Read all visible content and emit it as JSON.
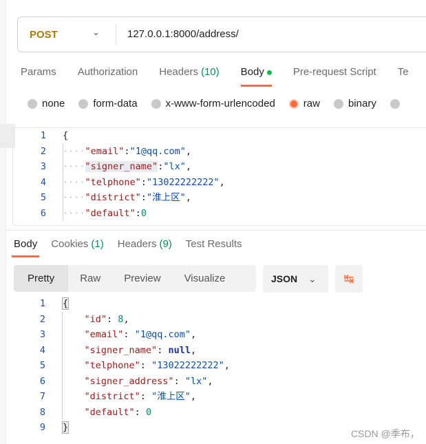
{
  "request": {
    "method": "POST",
    "url": "127.0.0.1:8000/address/"
  },
  "request_tabs": [
    {
      "label": "Params"
    },
    {
      "label": "Authorization"
    },
    {
      "label": "Headers",
      "count": "(10)"
    },
    {
      "label": "Body",
      "active": true
    },
    {
      "label": "Pre-request Script"
    },
    {
      "label": "Te"
    }
  ],
  "body_types": [
    {
      "label": "none"
    },
    {
      "label": "form-data"
    },
    {
      "label": "x-www-form-urlencoded"
    },
    {
      "label": "raw",
      "selected": true
    },
    {
      "label": "binary"
    },
    {
      "label": ""
    }
  ],
  "request_body": [
    {
      "n": "1",
      "text": "{"
    },
    {
      "n": "2",
      "key": "\"email\"",
      "val": "\"1@qq.com\"",
      "type": "s",
      "end": ","
    },
    {
      "n": "3",
      "key": "\"signer_name\"",
      "val": "\"lx\"",
      "type": "s",
      "end": ","
    },
    {
      "n": "4",
      "key": "\"telphone\"",
      "val": "\"13022222222\"",
      "type": "s",
      "end": ","
    },
    {
      "n": "5",
      "key": "\"district\"",
      "val": "\"淮上区\"",
      "type": "s",
      "end": ","
    },
    {
      "n": "6",
      "key": "\"default\"",
      "val": "0",
      "type": "n",
      "end": ""
    }
  ],
  "response_tabs": [
    {
      "label": "Body",
      "active": true
    },
    {
      "label": "Cookies",
      "count": "(1)"
    },
    {
      "label": "Headers",
      "count": "(9)"
    },
    {
      "label": "Test Results"
    }
  ],
  "view_modes": [
    "Pretty",
    "Raw",
    "Preview",
    "Visualize"
  ],
  "format": "JSON",
  "response_body": [
    {
      "n": "1",
      "text": "{"
    },
    {
      "n": "2",
      "key": "\"id\"",
      "val": "8",
      "type": "n",
      "end": ","
    },
    {
      "n": "3",
      "key": "\"email\"",
      "val": "\"1@qq.com\"",
      "type": "s",
      "end": ","
    },
    {
      "n": "4",
      "key": "\"signer_name\"",
      "val": "null",
      "type": "nl",
      "end": ","
    },
    {
      "n": "5",
      "key": "\"telphone\"",
      "val": "\"13022222222\"",
      "type": "s",
      "end": ","
    },
    {
      "n": "6",
      "key": "\"signer_address\"",
      "val": "\"lx\"",
      "type": "s",
      "end": ","
    },
    {
      "n": "7",
      "key": "\"district\"",
      "val": "\"淮上区\"",
      "type": "s",
      "end": ","
    },
    {
      "n": "8",
      "key": "\"default\"",
      "val": "0",
      "type": "n",
      "end": ""
    },
    {
      "n": "9",
      "text": "}"
    }
  ],
  "watermark": "CSDN @季布，",
  "colors": {
    "accent": "#ff6c37",
    "method": "#ad7a03",
    "body_dot": "#0cbb52"
  }
}
